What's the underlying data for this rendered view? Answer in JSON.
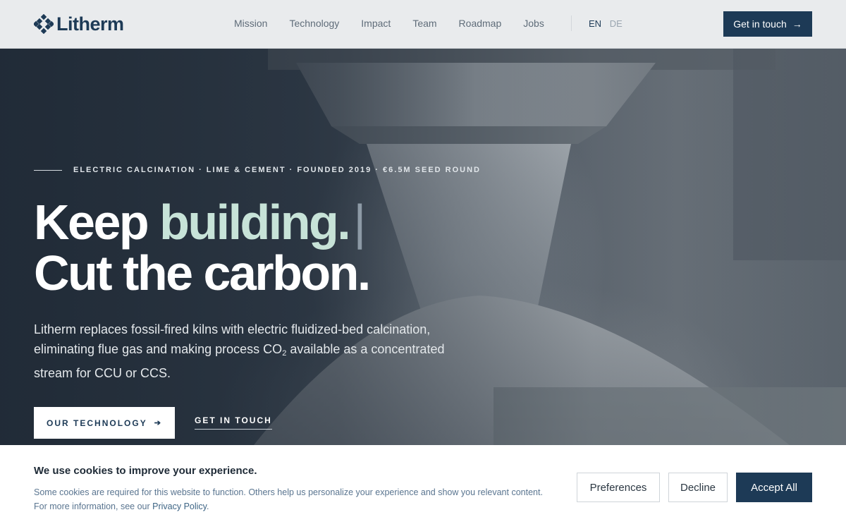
{
  "header": {
    "logo_text": "Litherm",
    "nav": [
      "Mission",
      "Technology",
      "Impact",
      "Team",
      "Roadmap",
      "Jobs"
    ],
    "lang_active": "EN",
    "lang_inactive": "DE",
    "cta_label": "Get in touch",
    "cta_icon": "arrow-right-icon"
  },
  "hero": {
    "eyebrow": "ELECTRIC CALCINATION · LIME & CEMENT · FOUNDED 2019 · €6.5M SEED ROUND",
    "headline_line1_a": "Keep",
    "headline_line1_b": "building.",
    "headline_cursor": "|",
    "headline_line2": "Cut the carbon.",
    "lead_before": "Litherm replaces fossil-fired kilns with electric fluidized-bed calcination, eliminating flue gas and making process CO",
    "lead_sub": "2",
    "lead_after": " available as a concentrated stream for CCU or CCS.",
    "primary_button": "OUR TECHNOLOGY",
    "primary_icon": "arrow-right-icon",
    "secondary_button": "GET IN TOUCH"
  },
  "cookie": {
    "title": "We use cookies to improve your experience.",
    "desc_line1": "Some cookies are required for this website to function. Others help us personalize your experience and show you relevant content.",
    "desc_line2_prefix": "For more information, see our ",
    "privacy_link": "Privacy Policy",
    "desc_line2_suffix": ".",
    "preferences": "Preferences",
    "decline": "Decline",
    "accept": "Accept All"
  },
  "colors": {
    "brand_navy": "#1d3a56",
    "accent_mint": "#c7e3d8"
  }
}
